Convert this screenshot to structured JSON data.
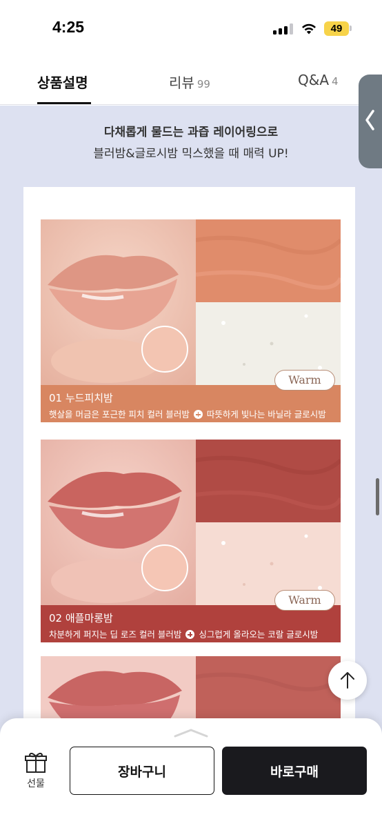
{
  "status_bar": {
    "time": "4:25",
    "battery": "49"
  },
  "tabs": [
    {
      "label": "상품설명",
      "count": ""
    },
    {
      "label": "리뷰",
      "count": "99"
    },
    {
      "label": "Q&A",
      "count": "4"
    }
  ],
  "headline": {
    "line1": "다채롭게 물드는 과즙 레이어링으로",
    "line2": "블러밤&글로시밤 믹스했을 때 매력 UP!"
  },
  "shades": [
    {
      "name": "01 누드피치밤",
      "desc_left": "햇살을 머금은 포근한 피치 컬러 블러밤",
      "desc_right": "따뜻하게 빛나는 바닐라 글로시밤",
      "badge": "Warm",
      "colors": {
        "caption": "#d88661",
        "blur": "#e08c6b",
        "glossy": "#f1efe8",
        "lip": "#e3a090",
        "skin": "#f1c9b8"
      }
    },
    {
      "name": "02 애플마롱밤",
      "desc_left": "차분하게 퍼지는 딥 로즈 컬러 블러밤",
      "desc_right": "싱그럽게 올라오는 코랄 글로시밤",
      "badge": "Warm",
      "colors": {
        "caption": "#b0413d",
        "blur": "#b04b45",
        "glossy": "#f6dcd3",
        "lip": "#d0706a",
        "skin": "#f1c7bc"
      }
    },
    {
      "name": "",
      "desc_left": "",
      "desc_right": "",
      "badge": "",
      "colors": {
        "caption": "#c2605a",
        "blur": "#c0615a",
        "glossy": "#f3d8cf",
        "lip": "#cf6e6e",
        "skin": "#f2cbc4"
      }
    }
  ],
  "bottom_bar": {
    "gift_label": "선물",
    "cart_label": "장바구니",
    "buy_label": "바로구매"
  },
  "icons": {
    "back_handle": "chevron-left-icon",
    "scroll_top": "arrow-up-icon",
    "gift": "gift-icon",
    "sheet_toggle": "chevron-up-icon"
  }
}
